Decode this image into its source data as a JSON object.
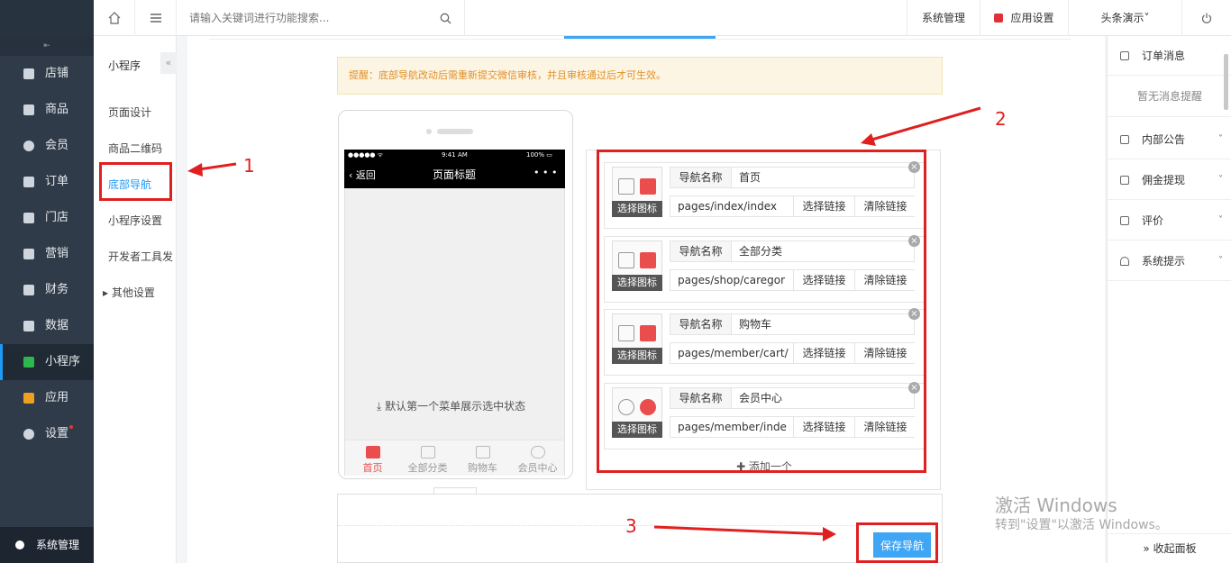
{
  "topbar": {
    "search_placeholder": "请输入关键词进行功能搜索...",
    "sys_mgmt": "系统管理",
    "app_settings": "应用设置",
    "account": "头条演示˅"
  },
  "sidebar": {
    "toggle": "⇤",
    "items": [
      {
        "label": "店铺"
      },
      {
        "label": "商品"
      },
      {
        "label": "会员"
      },
      {
        "label": "订单"
      },
      {
        "label": "门店"
      },
      {
        "label": "营销"
      },
      {
        "label": "财务"
      },
      {
        "label": "数据"
      },
      {
        "label": "小程序"
      },
      {
        "label": "应用"
      },
      {
        "label": "设置"
      }
    ],
    "footer": "系统管理"
  },
  "submenu": {
    "title": "小程序",
    "collapse": "«",
    "items": [
      "页面设计",
      "商品二维码",
      "底部导航",
      "小程序设置",
      "开发者工具发",
      "▸ 其他设置"
    ]
  },
  "notice": "提醒：底部导航改动后需重新提交微信审核，并且审核通过后才可生效。",
  "phone": {
    "carrier": "●●●●● ᯤ",
    "time": "9:41 AM",
    "battery": "100% ▭",
    "back": "‹ 返回",
    "page_title": "页面标题",
    "dots": "• • •",
    "default_hint": "⤓ 默认第一个菜单展示选中状态",
    "tabs": [
      "首页",
      "全部分类",
      "购物车",
      "会员中心"
    ]
  },
  "nav_items": [
    {
      "name_label": "导航名称",
      "name": "首页",
      "pick_icon": "选择图标",
      "path": "pages/index/index",
      "select_link": "选择链接",
      "clear_link": "清除链接"
    },
    {
      "name_label": "导航名称",
      "name": "全部分类",
      "pick_icon": "选择图标",
      "path": "pages/shop/caregor",
      "select_link": "选择链接",
      "clear_link": "清除链接"
    },
    {
      "name_label": "导航名称",
      "name": "购物车",
      "pick_icon": "选择图标",
      "path": "pages/member/cart/",
      "select_link": "选择链接",
      "clear_link": "清除链接"
    },
    {
      "name_label": "导航名称",
      "name": "会员中心",
      "pick_icon": "选择图标",
      "path": "pages/member/inde",
      "select_link": "选择链接",
      "clear_link": "清除链接"
    }
  ],
  "add_one": "✚ 添加一个",
  "save_label": "保存导航",
  "annotations": [
    "1",
    "2",
    "3"
  ],
  "rightpanel": {
    "order_msg": "订单消息",
    "no_msg": "暂无消息提醒",
    "announce": "内部公告",
    "commission": "佣金提现",
    "review": "评价",
    "sys_tip": "系统提示",
    "collapse": "» 收起面板"
  },
  "watermark": {
    "line1": "激活 Windows",
    "line2": "转到\"设置\"以激活 Windows。"
  },
  "colors": {
    "accent": "#3fa5f5",
    "annotation": "#e02020",
    "active_tab": "#e94d4d"
  }
}
